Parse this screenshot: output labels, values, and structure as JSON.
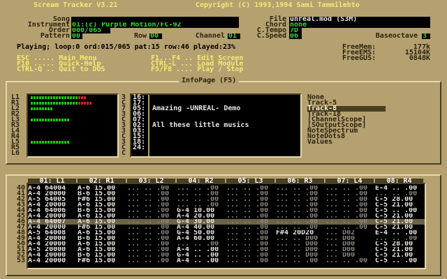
{
  "title": "Scream Tracker V3.21",
  "copyright": "Copyright (C) 1993,1994 Sami Tammilehto",
  "song": {
    "song_label": "Song",
    "instrument_label": "Instrument",
    "order_label": "Order",
    "pattern_label": "Pattern",
    "row_label": "Row",
    "channel_label": "Channel",
    "instrument_value": "01:(c) Purple Motion/FC-92",
    "order_value": "000/065",
    "pattern_value": "00",
    "row_value": "00",
    "channel_value": "01",
    "file_label": "File",
    "chord_label": "Chord",
    "ctempo_label": "C.Tempo",
    "cspeed_label": "C.Speed",
    "baseoctave_label": "Baseoctave",
    "file_value": "unreal.mod (S3M)",
    "chord_value": "none",
    "ctempo_value": "7D",
    "cspeed_value": "06",
    "baseoctave_value": "3"
  },
  "status": "Playing; loop:0 ord:015/065 pat:15 row:46 played:23%",
  "mem": {
    "freemem_label": "FreeMem:",
    "freeems_label": "FreeEMS:",
    "freegus_label": "FreeGUS:",
    "freemem_value": "177k",
    "freeems_value": "15104K",
    "freegus_value": "0848K"
  },
  "help": {
    "col1": [
      "ESC ..... Main Menu",
      "F10 ..... Quick-Help",
      "CTRL-Q .. Quit to DOS"
    ],
    "col2": [
      "F1...F4 .. Edit Screen",
      "CTRL-L ... Load Module",
      "F5/F8 .... Play / Stop"
    ]
  },
  "infopage_title": "InfoPage (F5)",
  "vu": {
    "labels": [
      "L1",
      "R1",
      "L2",
      "R2",
      "L3",
      "R3",
      "L4",
      "R4",
      "L5",
      "R5",
      "L6"
    ],
    "levels": [
      20,
      22,
      8,
      0,
      14,
      0,
      0,
      0,
      14,
      0,
      0
    ],
    "red_from": 17,
    "inst": [
      "3",
      "C",
      "7",
      "3",
      "C",
      "3",
      "3",
      "C",
      "3",
      "C",
      "C"
    ]
  },
  "samples": {
    "numbers": [
      "16:",
      "17:",
      "05:",
      "06:",
      "07:",
      "02:",
      "03:",
      "15:",
      "18:",
      "24:"
    ],
    "texts": [
      "",
      "",
      "Amazing -UNREAL- Demo",
      "",
      "",
      "All these little musics",
      "",
      "",
      "",
      ""
    ]
  },
  "infolist": [
    "None",
    "Track-5",
    "Track-8",
    "Track-18",
    "[ChannelScope]",
    "[SOutputScope]",
    "NoteSpectrum",
    "NoteDots8",
    "Values"
  ],
  "infolist_selected": 2,
  "pattern": {
    "headers": [
      "01: L1",
      "02: R1",
      "03: L2",
      "04: R2",
      "05: L3",
      "06: R3",
      "07: L4",
      "08: R4"
    ],
    "rownums": [
      "40",
      "41",
      "42",
      "43",
      "44",
      "45",
      "46",
      "47",
      "48",
      "49",
      "50",
      "51",
      "52",
      "53"
    ],
    "current": 6,
    "rows": [
      [
        "A-4 64004",
        "A-6 15.00",
        "... .. .00",
        "... .. .00",
        "... .. .00",
        "... .. .00",
        "... .. .00",
        "E-4 .. .00"
      ],
      [
        "A-4 20000",
        "B-6 15.00",
        "... .. .00",
        "... .. .00",
        "... .. .00",
        "... .. .00",
        "... .. .00",
        "... .. .00"
      ],
      [
        "A-5 64005",
        "F#6 15.00",
        "... .. .00",
        "... .. .00",
        "... .. .00",
        "... .. .00",
        "... .. .00",
        "C-5 28.00"
      ],
      [
        "A-4 20000",
        "A-6 15.00",
        "... .. .00",
        "... .. .00",
        "... .. .00",
        "... .. .00",
        "... .. .00",
        "C-5 21.00"
      ],
      [
        "A-4 64006",
        "B-6 15.00",
        "... .. .00",
        "G-4 10.00",
        "... .. .00",
        "... .. .00",
        "... .. .00",
        "C-5 .. .00"
      ],
      [
        "A-4 20000",
        "A-6 15.00",
        "... .. .00",
        "A-4 20.00",
        "... .. .00",
        "... .. .00",
        "... .. .00",
        "C-5 21.00"
      ],
      [
        "A-4 64007",
        "A-6 15.00",
        "... .. .00",
        "G-4 30.00",
        "... .. .00",
        "... .. .00",
        "... .. .00",
        "C-5 21.00"
      ],
      [
        "A-4 20000",
        "F#6 15.00",
        "... .. .00",
        "A-4 40.00",
        "... .. .00",
        "... .. .00",
        "... .. .00",
        "C-5 21.00"
      ],
      [
        "A-5 64008",
        "A-6 15.00",
        "... .. .00",
        "G-4 50.00",
        "... .. .00",
        "F#4 20D20",
        "... D02",
        "E-4 .. .00"
      ],
      [
        "A-4 20000",
        "B-6 15.00",
        "... .. .00",
        "A-4 60.00",
        "... .. .00",
        "... .. D00",
        "... D00",
        "... .. .00"
      ],
      [
        "A-4 20000",
        "A-6 15.00",
        "... .. .00",
        "... .. .00",
        "... .. .00",
        "... .. D00",
        "... D00",
        "C-5 28.00"
      ],
      [
        "A-5 20000",
        "A-6 15.00",
        "... .. .00",
        "A-4 .. .00",
        "... .. .00",
        "... .. D00",
        "... D00",
        "C-5 21.00"
      ],
      [
        "A-4 20000",
        "B-6 15.00",
        "... .. .00",
        "G-4 .. .00",
        "... .. .00",
        "... .. D00",
        "... D00",
        "C-5 21.00"
      ],
      [
        "A-4 20000",
        "F#6 15.00",
        "... .. .00",
        "A-4 .. .00",
        "... .. .00",
        "... .. .00",
        "... .. .00",
        "C-5 .. .00"
      ]
    ]
  },
  "colors": {
    "bg": "#b5a070",
    "green": "#38d838",
    "yellow": "#f0ec70",
    "dark": "#4a3f22"
  }
}
